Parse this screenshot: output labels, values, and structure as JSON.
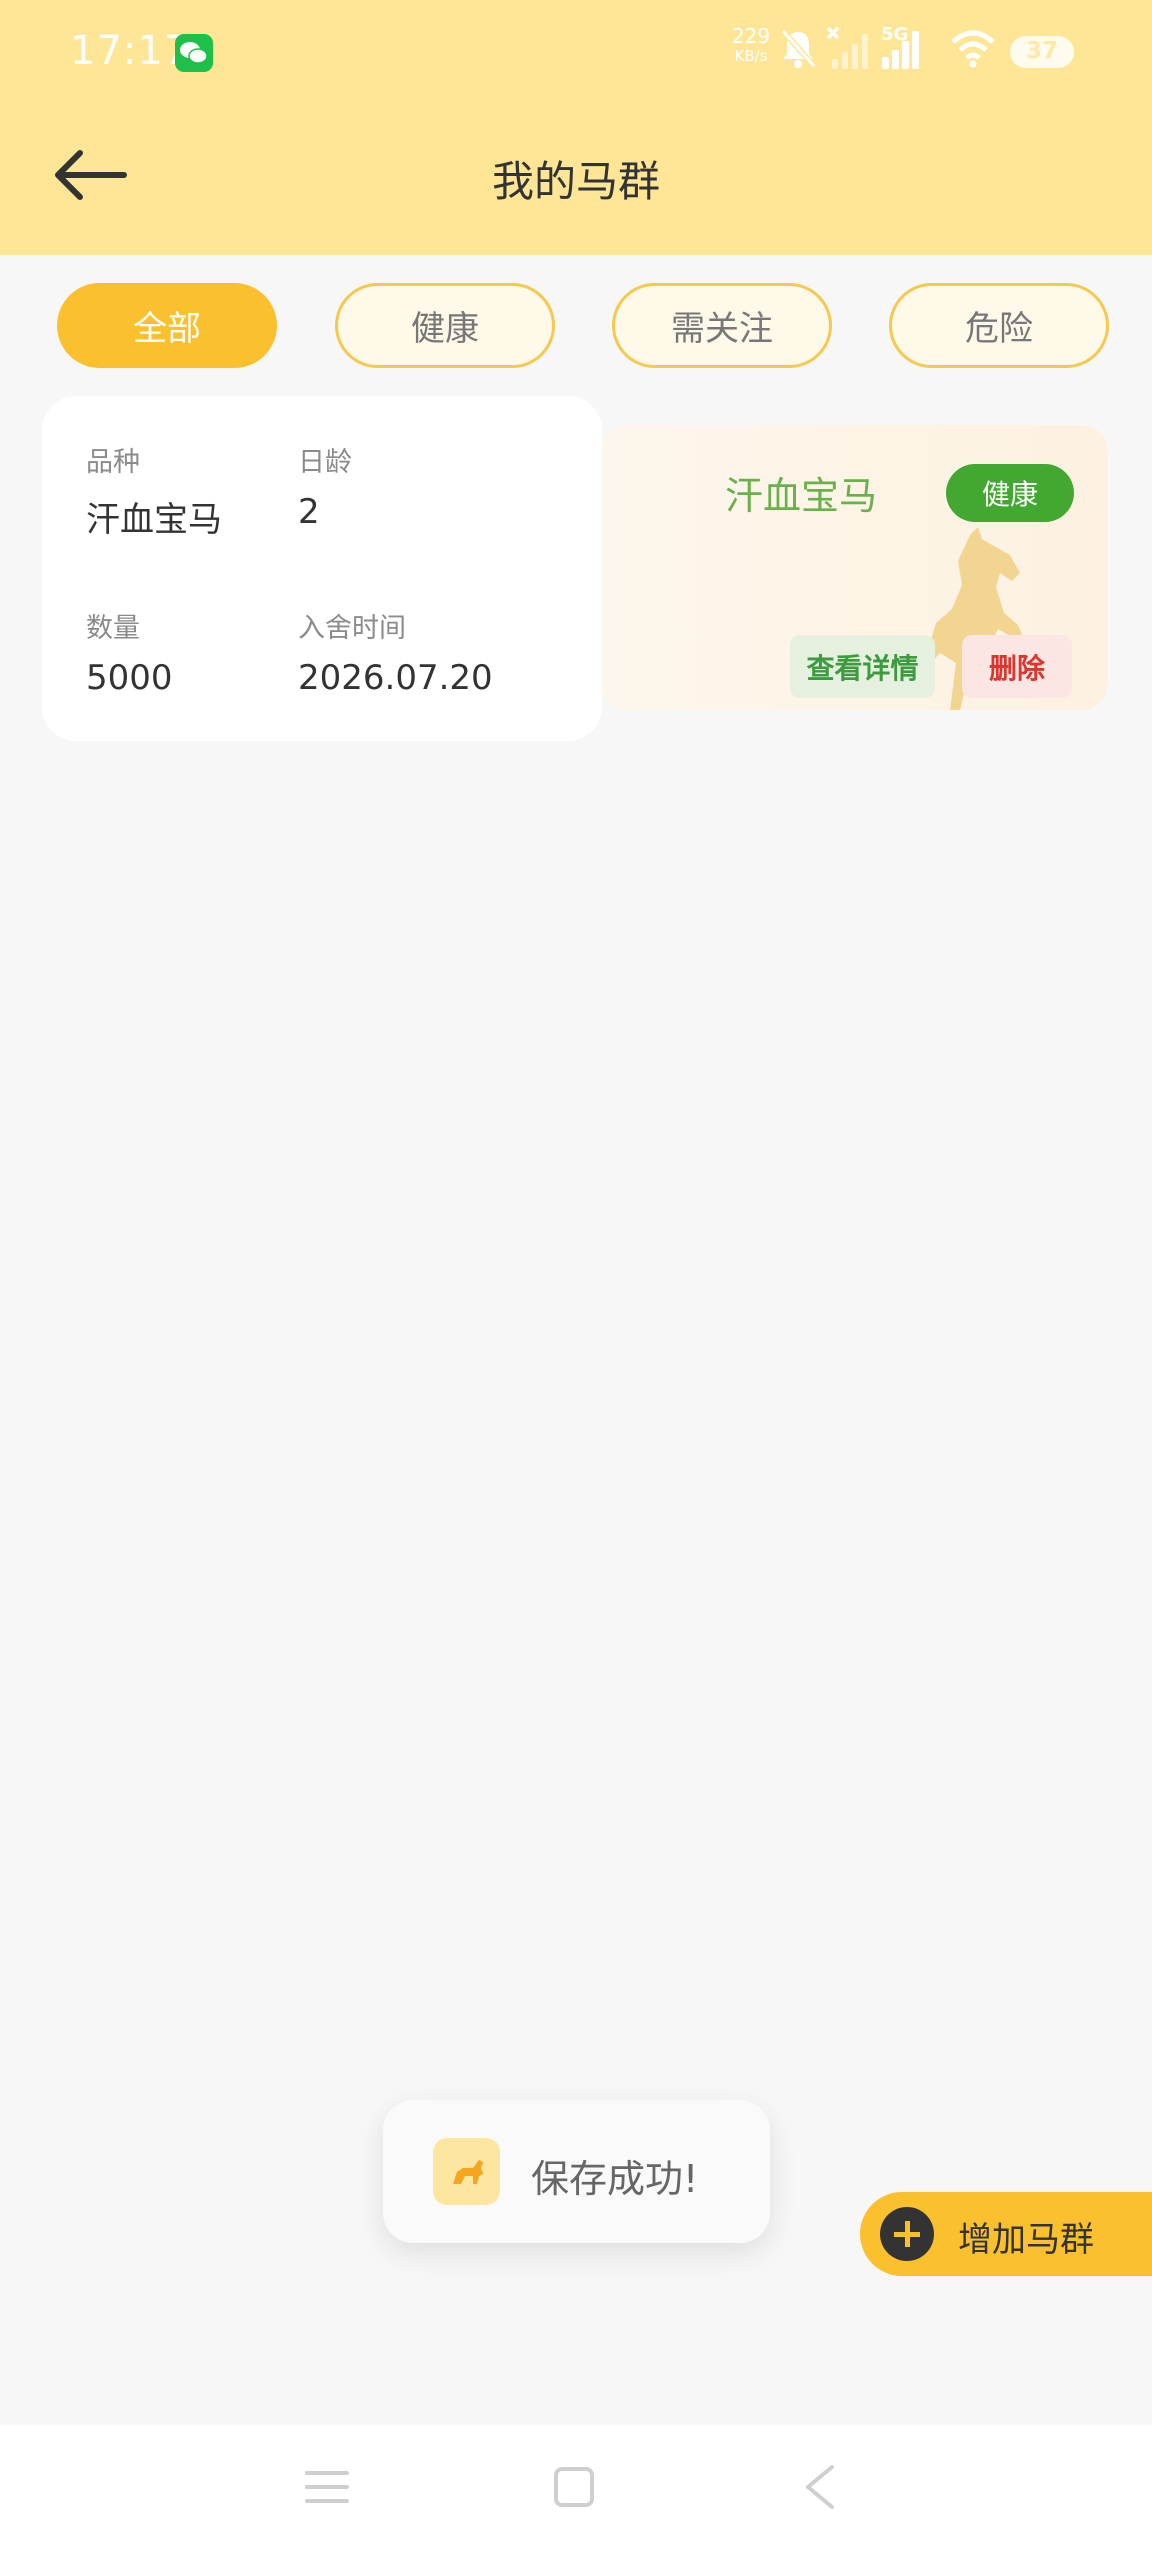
{
  "status_bar": {
    "time": "17:17",
    "net_speed_value": "229",
    "net_speed_unit": "KB/s",
    "network": "5G",
    "battery": "37",
    "icons": [
      "wechat-icon",
      "bell-muted-icon",
      "signal-off-icon",
      "signal-icon",
      "wifi-icon",
      "battery-icon"
    ]
  },
  "header": {
    "title": "我的马群",
    "back_icon": "arrow-left-icon"
  },
  "filters": {
    "active": "全部",
    "tabs": [
      {
        "label": "全部"
      },
      {
        "label": "健康"
      },
      {
        "label": "需关注"
      },
      {
        "label": "危险"
      }
    ]
  },
  "herds": [
    {
      "name": "汗血宝马",
      "status": "健康",
      "breed_label": "品种",
      "breed": "汗血宝马",
      "age_label": "日龄",
      "age": "2",
      "count_label": "数量",
      "count": "5000",
      "entry_label": "入舍时间",
      "entry_date": "2026.07.20",
      "detail_label": "查看详情",
      "delete_label": "删除"
    }
  ],
  "toast": {
    "text": "保存成功!"
  },
  "add_button": {
    "label": "增加马群"
  },
  "colors": {
    "header_bg": "#fee696",
    "accent": "#fbc02d",
    "healthy": "#43a832",
    "danger": "#d9362d"
  }
}
